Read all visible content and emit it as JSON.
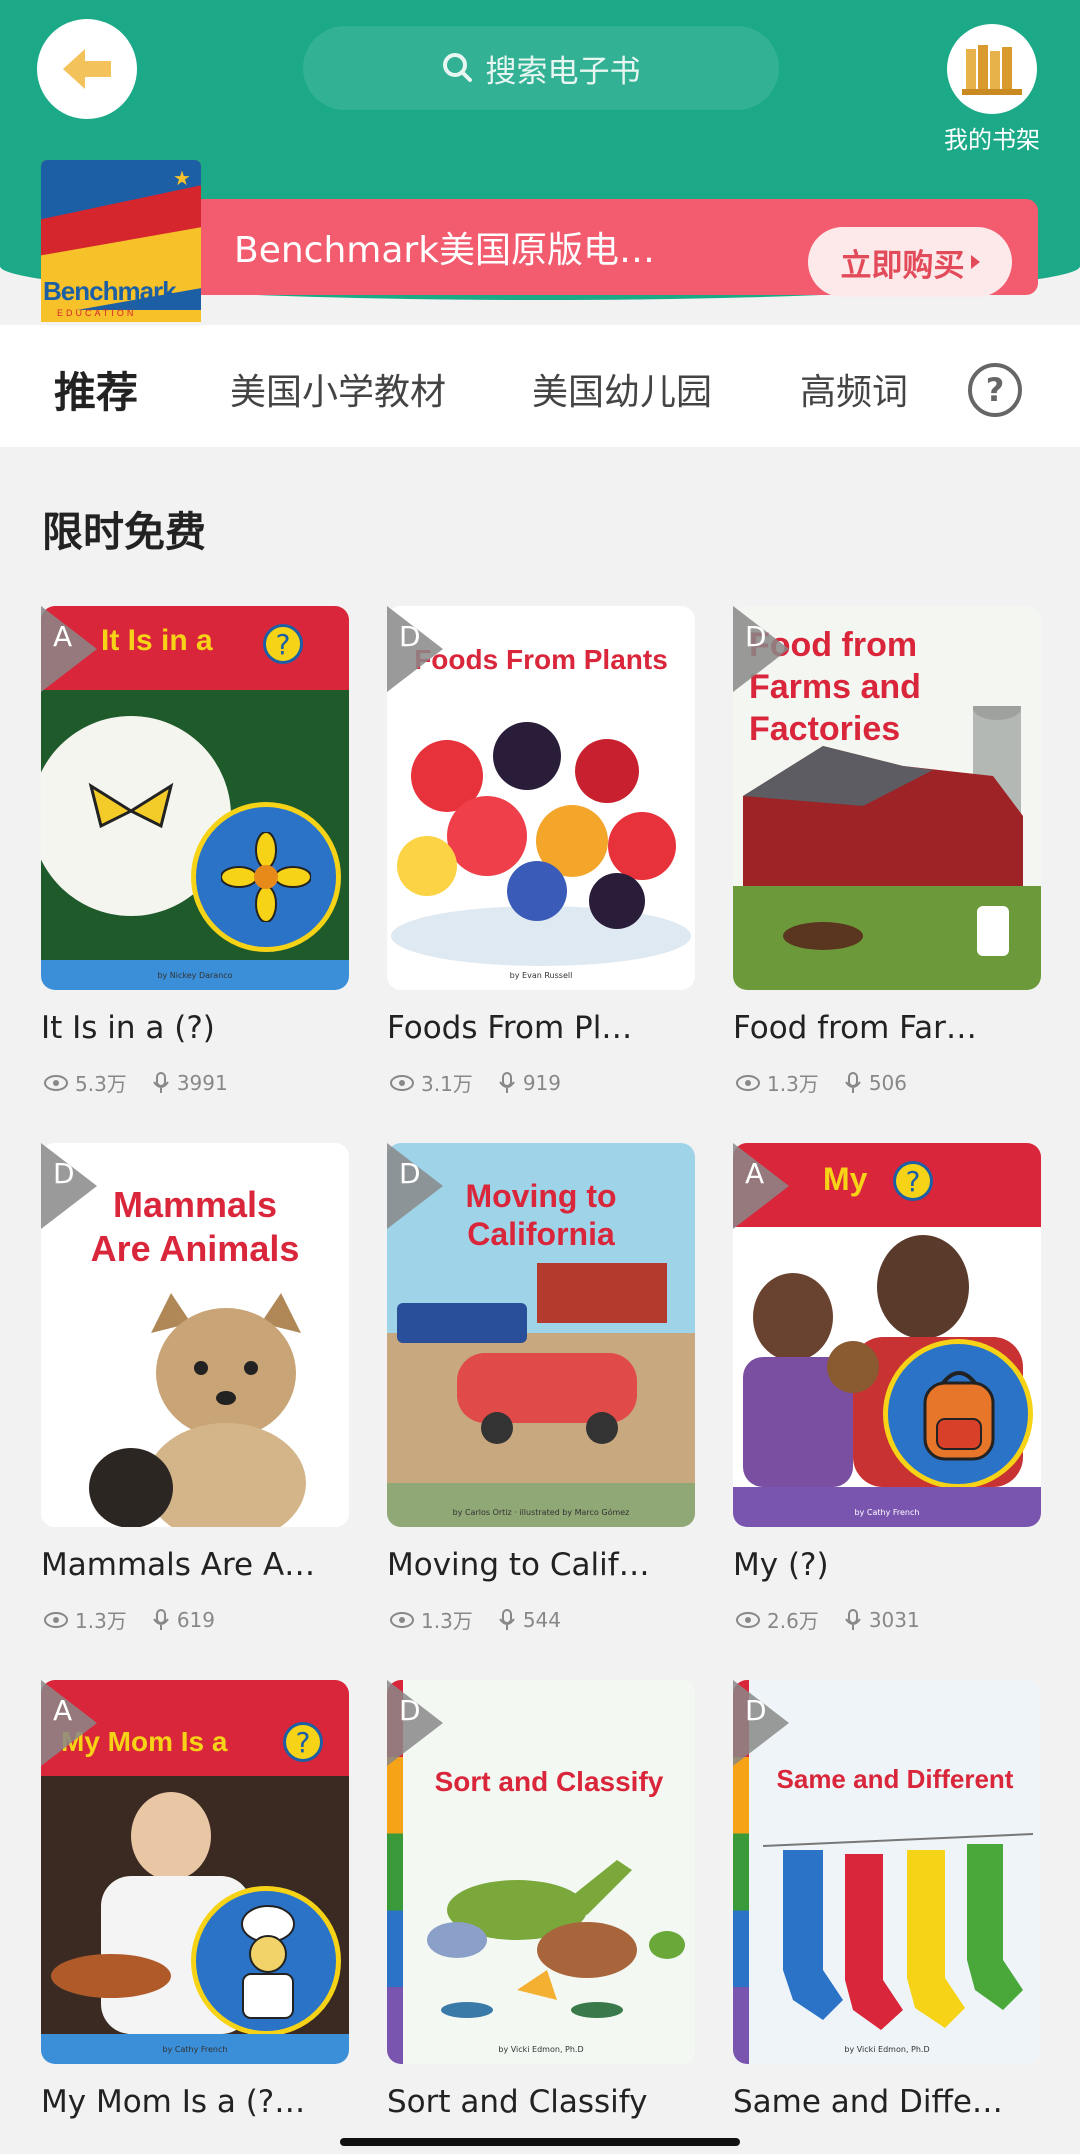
{
  "header": {
    "search_placeholder": "搜索电子书",
    "shelf_label": "我的书架"
  },
  "banner": {
    "logo_text": "Benchmark",
    "logo_sub": "EDUCATION",
    "title": "Benchmark美国原版电…",
    "buy_label": "立即购买"
  },
  "tabs": [
    {
      "label": "推荐",
      "active": true
    },
    {
      "label": "美国小学教材",
      "active": false
    },
    {
      "label": "美国幼儿园",
      "active": false
    },
    {
      "label": "高频词",
      "active": false
    }
  ],
  "help_label": "?",
  "section": {
    "title": "限时免费"
  },
  "books": [
    {
      "level": "A",
      "title": "It Is in a (?)",
      "views": "5.3万",
      "recordings": "3991",
      "cover_title": "It Is in a",
      "byline": "by Nickey Daranco"
    },
    {
      "level": "D",
      "title": "Foods From Pl…",
      "views": "3.1万",
      "recordings": "919",
      "cover_title": "Foods From Plants",
      "byline": "by Evan Russell"
    },
    {
      "level": "D",
      "title": "Food from Far…",
      "views": "1.3万",
      "recordings": "506",
      "cover_title": "Food from Farms and Factories",
      "byline": ""
    },
    {
      "level": "D",
      "title": "Mammals Are A…",
      "views": "1.3万",
      "recordings": "619",
      "cover_title": "Mammals Are Animals",
      "byline": ""
    },
    {
      "level": "D",
      "title": "Moving to Calif…",
      "views": "1.3万",
      "recordings": "544",
      "cover_title": "Moving to California",
      "byline": "by Carlos Ortiz · illustrated by Marco Gómez"
    },
    {
      "level": "A",
      "title": "My (?)",
      "views": "2.6万",
      "recordings": "3031",
      "cover_title": "My",
      "byline": "by Cathy French"
    },
    {
      "level": "A",
      "title": "My Mom Is a (?…",
      "views": "",
      "recordings": "",
      "cover_title": "My Mom Is a",
      "byline": "by Cathy French"
    },
    {
      "level": "D",
      "title": "Sort and Classify",
      "views": "",
      "recordings": "",
      "cover_title": "Sort and Classify",
      "byline": "by Vicki Edmon, Ph.D"
    },
    {
      "level": "D",
      "title": "Same and Diffe…",
      "views": "",
      "recordings": "",
      "cover_title": "Same and Different",
      "byline": "by Vicki Edmon, Ph.D"
    }
  ],
  "colors": {
    "header_green": "#1ba988",
    "banner_red": "#f25c6e",
    "accent_red": "#d5262e",
    "cover_blue": "#1d5fa5"
  }
}
